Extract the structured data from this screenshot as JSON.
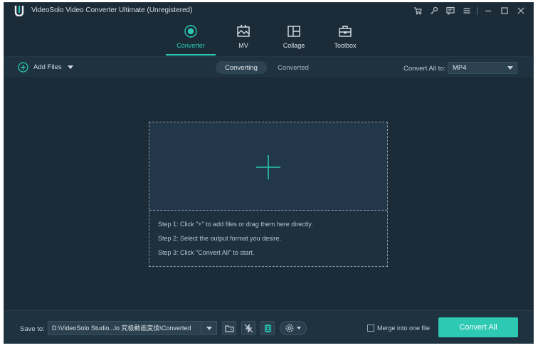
{
  "window": {
    "title": "VideoSolo Video Converter Ultimate (Unregistered)"
  },
  "window_controls": [
    {
      "name": "cart-icon"
    },
    {
      "name": "key-icon"
    },
    {
      "name": "feedback-icon"
    },
    {
      "name": "menu-icon"
    },
    {
      "name": "minimize-icon"
    },
    {
      "name": "maximize-icon"
    },
    {
      "name": "close-icon"
    }
  ],
  "nav": {
    "tabs": [
      {
        "label": "Converter",
        "icon": "converter-icon",
        "active": true
      },
      {
        "label": "MV",
        "icon": "mv-icon",
        "active": false
      },
      {
        "label": "Collage",
        "icon": "collage-icon",
        "active": false
      },
      {
        "label": "Toolbox",
        "icon": "toolbox-icon",
        "active": false
      }
    ]
  },
  "toolbar": {
    "add_files_label": "Add Files",
    "seg_converting": "Converting",
    "seg_converted": "Converted",
    "convert_all_to_label": "Convert All to:",
    "format_value": "MP4"
  },
  "drop_zone": {
    "steps": [
      "Step 1: Click \"+\" to add files or drag them here directly.",
      "Step 2: Select the output format you desire.",
      "Step 3: Click \"Convert All\" to start."
    ]
  },
  "bottom": {
    "save_to_label": "Save to:",
    "path_value": "D:\\VideoSolo Studio...lo 究极動画変換\\Converted",
    "merge_label": "Merge into one file",
    "convert_all_label": "Convert All"
  },
  "colors": {
    "accent": "#2ec9b3",
    "background": "#1b2b38",
    "panel": "#1f3240"
  }
}
